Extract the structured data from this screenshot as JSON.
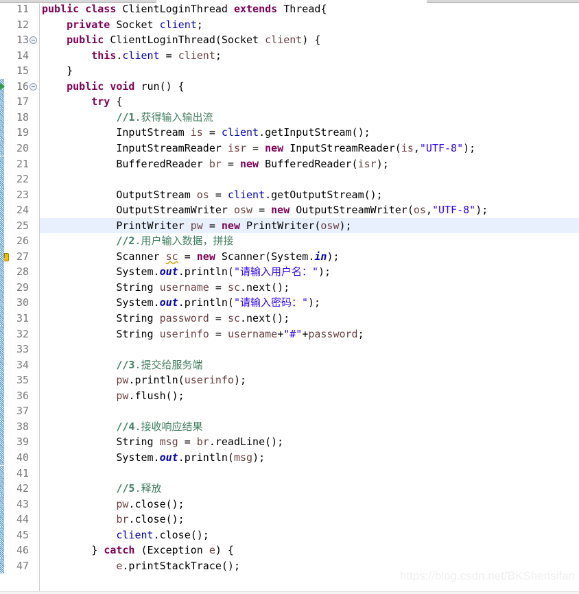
{
  "editor": {
    "kind": "java-source-editor",
    "first_line_number": 11,
    "current_line": 25,
    "line_height": 22.55,
    "colors": {
      "background": "#ffffff",
      "keyword": "#7f0055",
      "string": "#2a00ff",
      "comment": "#3f7f5f",
      "field": "#0000c0",
      "local_variable": "#6a3e3e",
      "line_number": "#787878",
      "current_line_highlight": "#e8f0fd",
      "change_bar": "#3f8ec4",
      "warning": "#f0c000",
      "run_marker": "#2f9e44"
    }
  },
  "markers": {
    "fold_collapse_lines": [
      13,
      16
    ],
    "warning_lines": [
      27
    ],
    "run_marker_line": 16,
    "change_bar_lines": [
      16,
      17,
      18,
      19,
      20,
      21,
      22,
      23,
      24,
      25,
      26,
      27,
      28,
      29,
      30,
      31,
      32,
      33,
      34,
      35,
      36,
      37,
      38,
      39,
      40,
      41,
      42,
      43,
      44,
      45,
      46,
      47
    ]
  },
  "lines": [
    {
      "n": 11,
      "tokens": [
        {
          "t": "public",
          "c": "kw"
        },
        {
          "t": " ",
          "c": "plain"
        },
        {
          "t": "class",
          "c": "kw"
        },
        {
          "t": " ClientLoginThread ",
          "c": "plain"
        },
        {
          "t": "extends",
          "c": "kw"
        },
        {
          "t": " Thread{",
          "c": "plain"
        }
      ]
    },
    {
      "n": 12,
      "tokens": [
        {
          "t": "    ",
          "c": "plain"
        },
        {
          "t": "private",
          "c": "kw"
        },
        {
          "t": " Socket ",
          "c": "plain"
        },
        {
          "t": "client",
          "c": "field"
        },
        {
          "t": ";",
          "c": "plain"
        }
      ]
    },
    {
      "n": 13,
      "tokens": [
        {
          "t": "    ",
          "c": "plain"
        },
        {
          "t": "public",
          "c": "kw"
        },
        {
          "t": " ClientLoginThread(Socket ",
          "c": "plain"
        },
        {
          "t": "client",
          "c": "local"
        },
        {
          "t": ") {",
          "c": "plain"
        }
      ]
    },
    {
      "n": 14,
      "tokens": [
        {
          "t": "        ",
          "c": "plain"
        },
        {
          "t": "this",
          "c": "kw"
        },
        {
          "t": ".",
          "c": "plain"
        },
        {
          "t": "client",
          "c": "field"
        },
        {
          "t": " = ",
          "c": "plain"
        },
        {
          "t": "client",
          "c": "local"
        },
        {
          "t": ";",
          "c": "plain"
        }
      ]
    },
    {
      "n": 15,
      "tokens": [
        {
          "t": "    }",
          "c": "plain"
        }
      ]
    },
    {
      "n": 16,
      "tokens": [
        {
          "t": "    ",
          "c": "plain"
        },
        {
          "t": "public",
          "c": "kw"
        },
        {
          "t": " ",
          "c": "plain"
        },
        {
          "t": "void",
          "c": "kw"
        },
        {
          "t": " run() {",
          "c": "plain"
        }
      ]
    },
    {
      "n": 17,
      "tokens": [
        {
          "t": "        ",
          "c": "plain"
        },
        {
          "t": "try",
          "c": "kw"
        },
        {
          "t": " {",
          "c": "plain"
        }
      ]
    },
    {
      "n": 18,
      "tokens": [
        {
          "t": "            ",
          "c": "plain"
        },
        {
          "t": "//1",
          "c": "cmt-num"
        },
        {
          "t": ".获得输入输出流",
          "c": "cmt"
        }
      ]
    },
    {
      "n": 19,
      "tokens": [
        {
          "t": "            InputStream ",
          "c": "plain"
        },
        {
          "t": "is",
          "c": "local"
        },
        {
          "t": " = ",
          "c": "plain"
        },
        {
          "t": "client",
          "c": "field"
        },
        {
          "t": ".getInputStream();",
          "c": "plain"
        }
      ]
    },
    {
      "n": 20,
      "tokens": [
        {
          "t": "            InputStreamReader ",
          "c": "plain"
        },
        {
          "t": "isr",
          "c": "local"
        },
        {
          "t": " = ",
          "c": "plain"
        },
        {
          "t": "new",
          "c": "kw"
        },
        {
          "t": " InputStreamReader(",
          "c": "plain"
        },
        {
          "t": "is",
          "c": "local"
        },
        {
          "t": ",",
          "c": "plain"
        },
        {
          "t": "\"UTF-8\"",
          "c": "str"
        },
        {
          "t": ");",
          "c": "plain"
        }
      ]
    },
    {
      "n": 21,
      "tokens": [
        {
          "t": "            BufferedReader ",
          "c": "plain"
        },
        {
          "t": "br",
          "c": "local"
        },
        {
          "t": " = ",
          "c": "plain"
        },
        {
          "t": "new",
          "c": "kw"
        },
        {
          "t": " BufferedReader(",
          "c": "plain"
        },
        {
          "t": "isr",
          "c": "local"
        },
        {
          "t": ");",
          "c": "plain"
        }
      ]
    },
    {
      "n": 22,
      "tokens": [
        {
          "t": "",
          "c": "plain"
        }
      ]
    },
    {
      "n": 23,
      "tokens": [
        {
          "t": "            OutputStream ",
          "c": "plain"
        },
        {
          "t": "os",
          "c": "local"
        },
        {
          "t": " = ",
          "c": "plain"
        },
        {
          "t": "client",
          "c": "field"
        },
        {
          "t": ".getOutputStream();",
          "c": "plain"
        }
      ]
    },
    {
      "n": 24,
      "tokens": [
        {
          "t": "            OutputStreamWriter ",
          "c": "plain"
        },
        {
          "t": "osw",
          "c": "local"
        },
        {
          "t": " = ",
          "c": "plain"
        },
        {
          "t": "new",
          "c": "kw"
        },
        {
          "t": " OutputStreamWriter(",
          "c": "plain"
        },
        {
          "t": "os",
          "c": "local"
        },
        {
          "t": ",",
          "c": "plain"
        },
        {
          "t": "\"UTF-8\"",
          "c": "str"
        },
        {
          "t": ");",
          "c": "plain"
        }
      ]
    },
    {
      "n": 25,
      "tokens": [
        {
          "t": "            PrintWriter ",
          "c": "plain"
        },
        {
          "t": "pw",
          "c": "local"
        },
        {
          "t": " = ",
          "c": "plain"
        },
        {
          "t": "new",
          "c": "kw"
        },
        {
          "t": " PrintWriter(",
          "c": "plain"
        },
        {
          "t": "osw",
          "c": "local"
        },
        {
          "t": ");",
          "c": "plain"
        }
      ]
    },
    {
      "n": 26,
      "tokens": [
        {
          "t": "            ",
          "c": "plain"
        },
        {
          "t": "//2",
          "c": "cmt-num"
        },
        {
          "t": ".用户输入数据，拼接",
          "c": "cmt"
        }
      ]
    },
    {
      "n": 27,
      "tokens": [
        {
          "t": "            Scanner ",
          "c": "plain"
        },
        {
          "t": "sc",
          "c": "local-warn"
        },
        {
          "t": " = ",
          "c": "plain"
        },
        {
          "t": "new",
          "c": "kw"
        },
        {
          "t": " Scanner(System.",
          "c": "plain"
        },
        {
          "t": "in",
          "c": "static"
        },
        {
          "t": ");",
          "c": "plain"
        }
      ]
    },
    {
      "n": 28,
      "tokens": [
        {
          "t": "            System.",
          "c": "plain"
        },
        {
          "t": "out",
          "c": "static"
        },
        {
          "t": ".println(",
          "c": "plain"
        },
        {
          "t": "\"请输入用户名：\"",
          "c": "str"
        },
        {
          "t": ");",
          "c": "plain"
        }
      ]
    },
    {
      "n": 29,
      "tokens": [
        {
          "t": "            String ",
          "c": "plain"
        },
        {
          "t": "username",
          "c": "local"
        },
        {
          "t": " = ",
          "c": "plain"
        },
        {
          "t": "sc",
          "c": "local"
        },
        {
          "t": ".next();",
          "c": "plain"
        }
      ]
    },
    {
      "n": 30,
      "tokens": [
        {
          "t": "            System.",
          "c": "plain"
        },
        {
          "t": "out",
          "c": "static"
        },
        {
          "t": ".println(",
          "c": "plain"
        },
        {
          "t": "\"请输入密码：\"",
          "c": "str"
        },
        {
          "t": ");",
          "c": "plain"
        }
      ]
    },
    {
      "n": 31,
      "tokens": [
        {
          "t": "            String ",
          "c": "plain"
        },
        {
          "t": "password",
          "c": "local"
        },
        {
          "t": " = ",
          "c": "plain"
        },
        {
          "t": "sc",
          "c": "local"
        },
        {
          "t": ".next();",
          "c": "plain"
        }
      ]
    },
    {
      "n": 32,
      "tokens": [
        {
          "t": "            String ",
          "c": "plain"
        },
        {
          "t": "userinfo",
          "c": "local"
        },
        {
          "t": " = ",
          "c": "plain"
        },
        {
          "t": "username",
          "c": "local"
        },
        {
          "t": "+",
          "c": "plain"
        },
        {
          "t": "\"#\"",
          "c": "str"
        },
        {
          "t": "+",
          "c": "plain"
        },
        {
          "t": "password",
          "c": "local"
        },
        {
          "t": ";",
          "c": "plain"
        }
      ]
    },
    {
      "n": 33,
      "tokens": [
        {
          "t": "",
          "c": "plain"
        }
      ]
    },
    {
      "n": 34,
      "tokens": [
        {
          "t": "            ",
          "c": "plain"
        },
        {
          "t": "//3",
          "c": "cmt-num"
        },
        {
          "t": ".提交给服务端",
          "c": "cmt"
        }
      ]
    },
    {
      "n": 35,
      "tokens": [
        {
          "t": "            ",
          "c": "plain"
        },
        {
          "t": "pw",
          "c": "local"
        },
        {
          "t": ".println(",
          "c": "plain"
        },
        {
          "t": "userinfo",
          "c": "local"
        },
        {
          "t": ");",
          "c": "plain"
        }
      ]
    },
    {
      "n": 36,
      "tokens": [
        {
          "t": "            ",
          "c": "plain"
        },
        {
          "t": "pw",
          "c": "local"
        },
        {
          "t": ".flush();",
          "c": "plain"
        }
      ]
    },
    {
      "n": 37,
      "tokens": [
        {
          "t": "",
          "c": "plain"
        }
      ]
    },
    {
      "n": 38,
      "tokens": [
        {
          "t": "            ",
          "c": "plain"
        },
        {
          "t": "//4",
          "c": "cmt-num"
        },
        {
          "t": ".接收响应结果",
          "c": "cmt"
        }
      ]
    },
    {
      "n": 39,
      "tokens": [
        {
          "t": "            String ",
          "c": "plain"
        },
        {
          "t": "msg",
          "c": "local"
        },
        {
          "t": " = ",
          "c": "plain"
        },
        {
          "t": "br",
          "c": "local"
        },
        {
          "t": ".readLine();",
          "c": "plain"
        }
      ]
    },
    {
      "n": 40,
      "tokens": [
        {
          "t": "            System.",
          "c": "plain"
        },
        {
          "t": "out",
          "c": "static"
        },
        {
          "t": ".println(",
          "c": "plain"
        },
        {
          "t": "msg",
          "c": "local"
        },
        {
          "t": ");",
          "c": "plain"
        }
      ]
    },
    {
      "n": 41,
      "tokens": [
        {
          "t": "",
          "c": "plain"
        }
      ]
    },
    {
      "n": 42,
      "tokens": [
        {
          "t": "            ",
          "c": "plain"
        },
        {
          "t": "//5",
          "c": "cmt-num"
        },
        {
          "t": ".释放",
          "c": "cmt"
        }
      ]
    },
    {
      "n": 43,
      "tokens": [
        {
          "t": "            ",
          "c": "plain"
        },
        {
          "t": "pw",
          "c": "local"
        },
        {
          "t": ".close();",
          "c": "plain"
        }
      ]
    },
    {
      "n": 44,
      "tokens": [
        {
          "t": "            ",
          "c": "plain"
        },
        {
          "t": "br",
          "c": "local"
        },
        {
          "t": ".close();",
          "c": "plain"
        }
      ]
    },
    {
      "n": 45,
      "tokens": [
        {
          "t": "            ",
          "c": "plain"
        },
        {
          "t": "client",
          "c": "field"
        },
        {
          "t": ".close();",
          "c": "plain"
        }
      ]
    },
    {
      "n": 46,
      "tokens": [
        {
          "t": "        } ",
          "c": "plain"
        },
        {
          "t": "catch",
          "c": "kw"
        },
        {
          "t": " (Exception ",
          "c": "plain"
        },
        {
          "t": "e",
          "c": "local"
        },
        {
          "t": ") {",
          "c": "plain"
        }
      ]
    },
    {
      "n": 47,
      "tokens": [
        {
          "t": "            ",
          "c": "plain"
        },
        {
          "t": "e",
          "c": "local"
        },
        {
          "t": ".printStackTrace();",
          "c": "plain"
        }
      ]
    }
  ],
  "watermark": {
    "text": "https://blog.csdn.net/BKShensifan"
  }
}
